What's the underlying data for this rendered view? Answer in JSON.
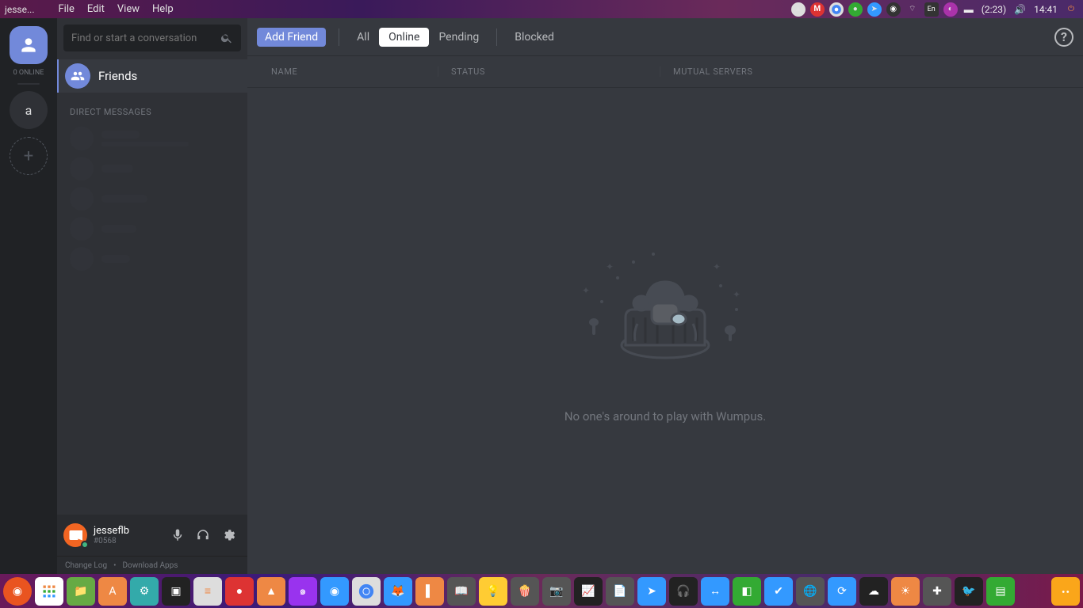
{
  "os": {
    "app_title": "jesse...",
    "menu": [
      "File",
      "Edit",
      "View",
      "Help"
    ],
    "tray": {
      "battery_time": "(2:23)",
      "clock": "14:41",
      "lang": "En"
    }
  },
  "guild_rail": {
    "online_label": "0 ONLINE",
    "server_letter": "a"
  },
  "sidebar": {
    "search_placeholder": "Find or start a conversation",
    "friends_label": "Friends",
    "dm_header": "DIRECT MESSAGES"
  },
  "user_panel": {
    "username": "jesseflb",
    "discriminator": "#0568"
  },
  "footer": {
    "changelog": "Change Log",
    "separator": "•",
    "download": "Download Apps"
  },
  "main": {
    "tabs": {
      "add_friend": "Add Friend",
      "all": "All",
      "online": "Online",
      "pending": "Pending",
      "blocked": "Blocked"
    },
    "columns": {
      "name": "NAME",
      "status": "STATUS",
      "mutual": "MUTUAL SERVERS"
    },
    "empty_text": "No one's around to play with Wumpus."
  }
}
